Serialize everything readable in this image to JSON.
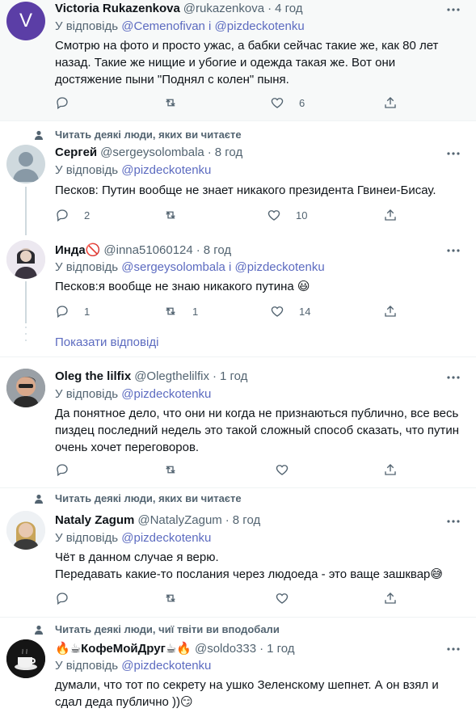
{
  "tweets": [
    {
      "name": "Victoria Rukazenkova",
      "handle": "@rukazenkova",
      "time": "4 год",
      "reply_prefix": "У відповідь",
      "reply_to": "@Cemenofivan і @pizdeckotenku",
      "text": "Смотрю на фото и просто ужас, а бабки сейчас такие же, как 80 лет назад. Такие же нищие и убогие и одежда такая же. Вот они достяжение пыни \"Поднял  с колен\" пыня.",
      "likes": "6",
      "avatar_letter": "V",
      "avatar_color": "#5b3ea6"
    },
    {
      "context": "Читать деякі люди, яких ви читаєте",
      "name": "Сергей",
      "handle": "@sergeysolombala",
      "time": "8 год",
      "reply_prefix": "У відповідь",
      "reply_to": "@pizdeckotenku",
      "text": "Песков: Путин вообще не знает никакого президента Гвинеи-Бисау.",
      "replies": "2",
      "likes": "10"
    },
    {
      "name": "Инда🚫",
      "handle": "@inna51060124",
      "time": "8 год",
      "reply_prefix": "У відповідь",
      "reply_to": "@sergeysolombala і @pizdeckotenku",
      "text": "Песков:я вообще не знаю никакого путина 😃",
      "replies": "1",
      "retweets": "1",
      "likes": "14"
    },
    {
      "name": "Oleg the lilfix",
      "handle": "@Olegthelilfix",
      "time": "1 год",
      "reply_prefix": "У відповідь",
      "reply_to": "@pizdeckotenku",
      "text": "Да понятное дело, что они ни когда не признаються публично, все весь пиздец последний недель это такой сложный способ сказать, что путин очень хочет переговоров."
    },
    {
      "context": "Читать деякі люди, яких ви читаєте",
      "name": "Nataly Zagum",
      "handle": "@NatalyZagum",
      "time": "8 год",
      "reply_prefix": "У відповідь",
      "reply_to": "@pizdeckotenku",
      "text_line1": "Чёт в данном случае я верю.",
      "text_line2": "Передавать какие-то послания через людоеда - это ваще зашквар😅"
    },
    {
      "context": "Читать деякі люди, чиї твіти ви вподобали",
      "name": "🔥☕КофеМойДруг☕🔥",
      "handle": "@soldo333",
      "time": "1 год",
      "reply_prefix": "У відповідь",
      "reply_to": "@pizdeckotenku",
      "text": "думали, что тот по секрету на ушко Зеленскому шепнет. А он взял и сдал деда публично ))😏"
    }
  ],
  "show_replies": "Показати відповіді",
  "dot": "·",
  "colors": {
    "link": "#5c6bc0",
    "muted": "#536471",
    "highlight_bg": "#f7f9f9"
  }
}
